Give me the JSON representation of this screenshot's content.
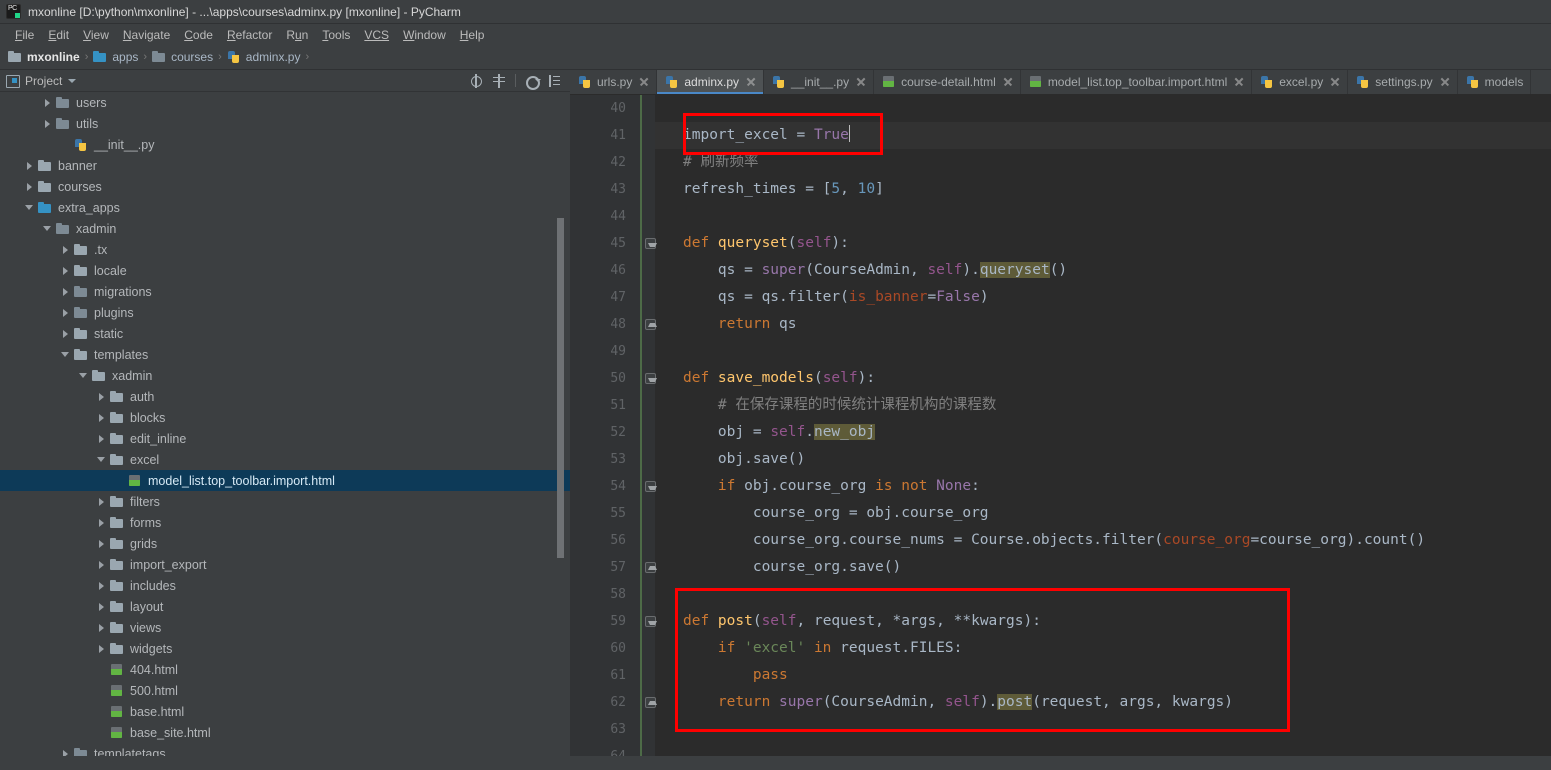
{
  "window": {
    "title": "mxonline [D:\\python\\mxonline] - ...\\apps\\courses\\adminx.py [mxonline] - PyCharm",
    "app_icon": "pycharm-logo-icon"
  },
  "menubar": {
    "items": [
      {
        "label": "File",
        "mnemonic": "F",
        "rest": "ile"
      },
      {
        "label": "Edit",
        "mnemonic": "E",
        "rest": "dit"
      },
      {
        "label": "View",
        "mnemonic": "V",
        "rest": "iew"
      },
      {
        "label": "Navigate",
        "mnemonic": "N",
        "rest": "avigate"
      },
      {
        "label": "Code",
        "mnemonic": "C",
        "rest": "ode"
      },
      {
        "label": "Refactor",
        "mnemonic": "R",
        "rest": "efactor"
      },
      {
        "label": "Run",
        "mnemonic": "u",
        "rest": "n",
        "pre": "R"
      },
      {
        "label": "Tools",
        "mnemonic": "T",
        "rest": "ools"
      },
      {
        "label": "VCS",
        "mnemonic": "VCS",
        "rest": ""
      },
      {
        "label": "Window",
        "mnemonic": "W",
        "rest": "indow"
      },
      {
        "label": "Help",
        "mnemonic": "H",
        "rest": "elp"
      }
    ]
  },
  "breadcrumb": {
    "items": [
      {
        "label": "mxonline",
        "icon": "folder-icon",
        "bold": true
      },
      {
        "label": "apps",
        "icon": "folder-blue-icon",
        "bold": false
      },
      {
        "label": "courses",
        "icon": "folder-icon",
        "bold": false
      },
      {
        "label": "adminx.py",
        "icon": "python-file-icon",
        "bold": false
      }
    ],
    "separator": "›"
  },
  "sidebar": {
    "title": "Project",
    "tools": [
      {
        "name": "locate-in-tree-icon"
      },
      {
        "name": "collapse-all-icon"
      },
      {
        "name": "settings-gear-icon"
      },
      {
        "name": "hide-panel-icon"
      }
    ],
    "tree": [
      {
        "label": "users",
        "indent": 2,
        "arrow": "right",
        "icon": "folder-module-icon",
        "selected": false
      },
      {
        "label": "utils",
        "indent": 2,
        "arrow": "right",
        "icon": "folder-module-icon",
        "selected": false
      },
      {
        "label": "__init__.py",
        "indent": 3,
        "arrow": "none",
        "icon": "python-file-icon",
        "selected": false
      },
      {
        "label": "banner",
        "indent": 1,
        "arrow": "right",
        "icon": "folder-icon",
        "selected": false
      },
      {
        "label": "courses",
        "indent": 1,
        "arrow": "right",
        "icon": "folder-icon",
        "selected": false
      },
      {
        "label": "extra_apps",
        "indent": 1,
        "arrow": "down",
        "icon": "folder-blue-icon",
        "selected": false
      },
      {
        "label": "xadmin",
        "indent": 2,
        "arrow": "down",
        "icon": "folder-module-icon",
        "selected": false
      },
      {
        "label": ".tx",
        "indent": 3,
        "arrow": "right",
        "icon": "folder-icon",
        "selected": false
      },
      {
        "label": "locale",
        "indent": 3,
        "arrow": "right",
        "icon": "folder-icon",
        "selected": false
      },
      {
        "label": "migrations",
        "indent": 3,
        "arrow": "right",
        "icon": "folder-module-icon",
        "selected": false
      },
      {
        "label": "plugins",
        "indent": 3,
        "arrow": "right",
        "icon": "folder-module-icon",
        "selected": false
      },
      {
        "label": "static",
        "indent": 3,
        "arrow": "right",
        "icon": "folder-icon",
        "selected": false
      },
      {
        "label": "templates",
        "indent": 3,
        "arrow": "down",
        "icon": "folder-icon",
        "selected": false
      },
      {
        "label": "xadmin",
        "indent": 4,
        "arrow": "down",
        "icon": "folder-icon",
        "selected": false
      },
      {
        "label": "auth",
        "indent": 5,
        "arrow": "right",
        "icon": "folder-icon",
        "selected": false
      },
      {
        "label": "blocks",
        "indent": 5,
        "arrow": "right",
        "icon": "folder-icon",
        "selected": false
      },
      {
        "label": "edit_inline",
        "indent": 5,
        "arrow": "right",
        "icon": "folder-icon",
        "selected": false
      },
      {
        "label": "excel",
        "indent": 5,
        "arrow": "down",
        "icon": "folder-icon",
        "selected": false
      },
      {
        "label": "model_list.top_toolbar.import.html",
        "indent": 6,
        "arrow": "none",
        "icon": "html-file-icon",
        "selected": true
      },
      {
        "label": "filters",
        "indent": 5,
        "arrow": "right",
        "icon": "folder-icon",
        "selected": false
      },
      {
        "label": "forms",
        "indent": 5,
        "arrow": "right",
        "icon": "folder-icon",
        "selected": false
      },
      {
        "label": "grids",
        "indent": 5,
        "arrow": "right",
        "icon": "folder-icon",
        "selected": false
      },
      {
        "label": "import_export",
        "indent": 5,
        "arrow": "right",
        "icon": "folder-icon",
        "selected": false
      },
      {
        "label": "includes",
        "indent": 5,
        "arrow": "right",
        "icon": "folder-icon",
        "selected": false
      },
      {
        "label": "layout",
        "indent": 5,
        "arrow": "right",
        "icon": "folder-icon",
        "selected": false
      },
      {
        "label": "views",
        "indent": 5,
        "arrow": "right",
        "icon": "folder-icon",
        "selected": false
      },
      {
        "label": "widgets",
        "indent": 5,
        "arrow": "right",
        "icon": "folder-icon",
        "selected": false
      },
      {
        "label": "404.html",
        "indent": 5,
        "arrow": "none",
        "icon": "html-file-icon",
        "selected": false
      },
      {
        "label": "500.html",
        "indent": 5,
        "arrow": "none",
        "icon": "html-file-icon",
        "selected": false
      },
      {
        "label": "base.html",
        "indent": 5,
        "arrow": "none",
        "icon": "html-file-icon",
        "selected": false
      },
      {
        "label": "base_site.html",
        "indent": 5,
        "arrow": "none",
        "icon": "html-file-icon",
        "selected": false
      },
      {
        "label": "templatetags",
        "indent": 3,
        "arrow": "right",
        "icon": "folder-module-icon",
        "selected": false
      }
    ]
  },
  "editor": {
    "tabs": [
      {
        "label": "urls.py",
        "icon": "python-file-icon",
        "active": false
      },
      {
        "label": "adminx.py",
        "icon": "python-file-icon",
        "active": true
      },
      {
        "label": "__init__.py",
        "icon": "python-file-icon",
        "active": false
      },
      {
        "label": "course-detail.html",
        "icon": "html-file-icon",
        "active": false
      },
      {
        "label": "model_list.top_toolbar.import.html",
        "icon": "html-file-icon",
        "active": false
      },
      {
        "label": "excel.py",
        "icon": "python-file-icon",
        "active": false
      },
      {
        "label": "settings.py",
        "icon": "python-file-icon",
        "active": false
      },
      {
        "label": "models",
        "icon": "python-file-icon",
        "active": false
      }
    ],
    "first_line_number": 40,
    "current_line": 41,
    "lines": [
      {
        "n": 40,
        "fold": "none"
      },
      {
        "n": 41,
        "fold": "none"
      },
      {
        "n": 42,
        "fold": "none"
      },
      {
        "n": 43,
        "fold": "none"
      },
      {
        "n": 44,
        "fold": "none"
      },
      {
        "n": 45,
        "fold": "down"
      },
      {
        "n": 46,
        "fold": "none"
      },
      {
        "n": 47,
        "fold": "none"
      },
      {
        "n": 48,
        "fold": "up"
      },
      {
        "n": 49,
        "fold": "none"
      },
      {
        "n": 50,
        "fold": "down"
      },
      {
        "n": 51,
        "fold": "none"
      },
      {
        "n": 52,
        "fold": "none"
      },
      {
        "n": 53,
        "fold": "none"
      },
      {
        "n": 54,
        "fold": "down"
      },
      {
        "n": 55,
        "fold": "none"
      },
      {
        "n": 56,
        "fold": "none"
      },
      {
        "n": 57,
        "fold": "up"
      },
      {
        "n": 58,
        "fold": "none"
      },
      {
        "n": 59,
        "fold": "down"
      },
      {
        "n": 60,
        "fold": "none"
      },
      {
        "n": 61,
        "fold": "none"
      },
      {
        "n": 62,
        "fold": "up"
      },
      {
        "n": 63,
        "fold": "none"
      },
      {
        "n": 64,
        "fold": "none"
      }
    ],
    "code_text": {
      "l41": "import_excel = True",
      "l42": "# 刷新频率",
      "l43": "refresh_times = [5, 10]",
      "l45": "def queryset(self):",
      "l46": "qs = super(CourseAdmin, self).queryset()",
      "l47": "qs = qs.filter(is_banner=False)",
      "l48": "return qs",
      "l50": "def save_models(self):",
      "l51": "# 在保存课程的时候统计课程机构的课程数",
      "l52": "obj = self.new_obj",
      "l53": "obj.save()",
      "l54": "if obj.course_org is not None:",
      "l55": "course_org = obj.course_org",
      "l56": "course_org.course_nums = Course.objects.filter(course_org=course_org).count()",
      "l57": "course_org.save()",
      "l59": "def post(self, request, *args, **kwargs):",
      "l60": "if 'excel' in request.FILES:",
      "l61": "pass",
      "l62": "return super(CourseAdmin, self).post(request, args, kwargs)"
    },
    "annotations": [
      {
        "name": "import-excel-highlight-box",
        "color": "#ff0000"
      },
      {
        "name": "post-method-highlight-box",
        "color": "#ff0000"
      }
    ]
  },
  "colors": {
    "accent": "#4a88c7",
    "annotation": "#ff0000",
    "editor_bg": "#2b2b2b",
    "chrome_bg": "#3c3f41",
    "selection": "#0d3a58"
  }
}
